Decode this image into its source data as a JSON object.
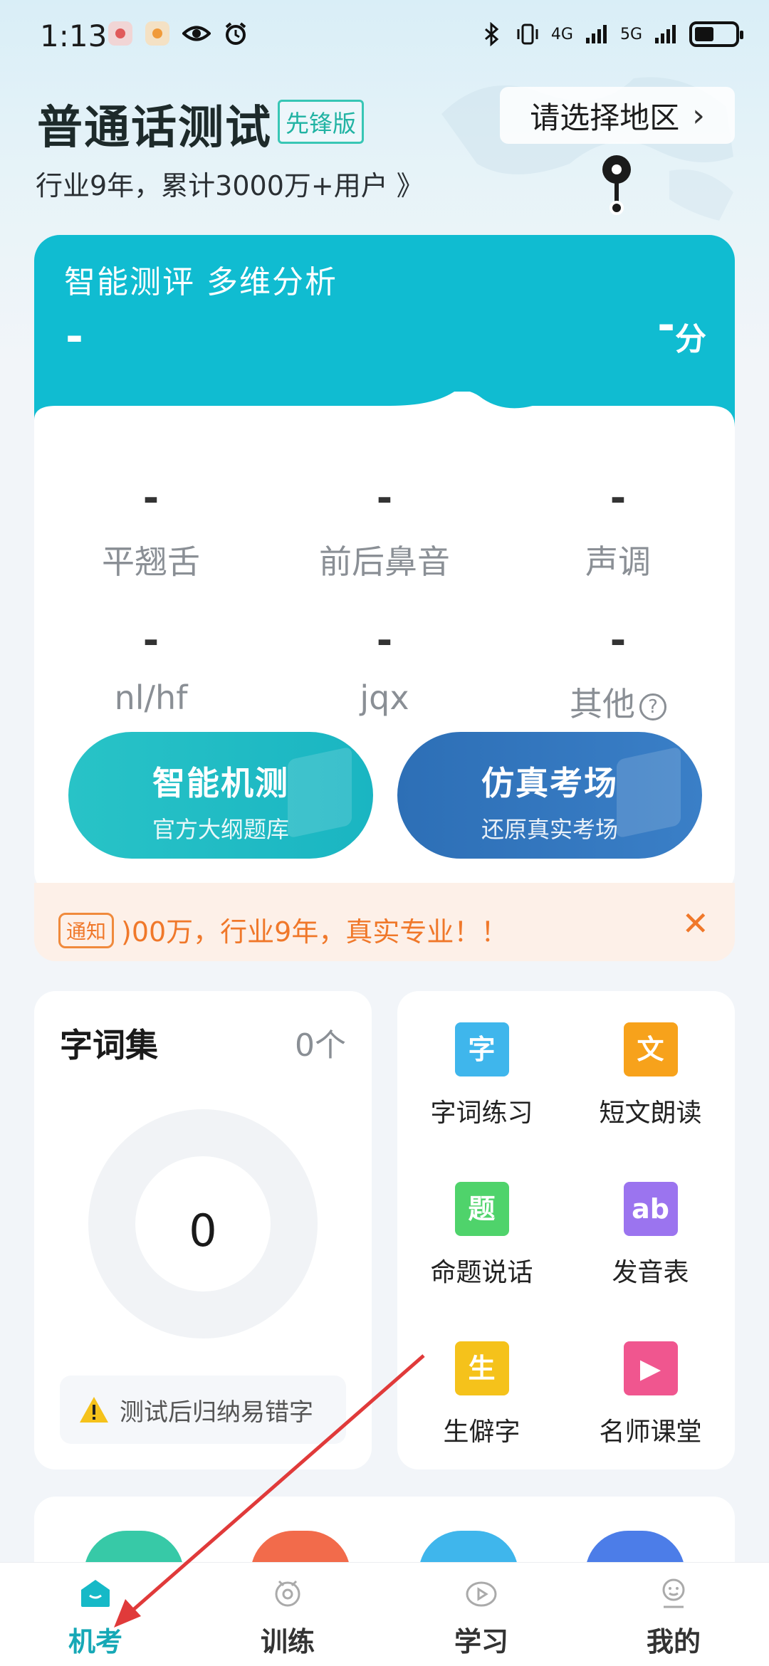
{
  "status_bar": {
    "time": "1:13",
    "network_4g": "4G",
    "network_5g": "5G"
  },
  "header": {
    "title": "普通话测试",
    "edition": "先锋版",
    "subtitle": "行业9年，累计3000万+用户 》",
    "region_label": "请选择地区"
  },
  "score_card": {
    "slogan": "智能测评 多维分析",
    "left_value": "-",
    "score_value": "-",
    "score_unit": "分",
    "metrics": [
      {
        "value": "-",
        "label": "平翘舌"
      },
      {
        "value": "-",
        "label": "前后鼻音"
      },
      {
        "value": "-",
        "label": "声调"
      },
      {
        "value": "-",
        "label": "nl/hf"
      },
      {
        "value": "-",
        "label": "jqx"
      },
      {
        "value": "-",
        "label": "其他"
      }
    ],
    "help_icon": "?",
    "buttons": [
      {
        "title": "智能机测",
        "subtitle": "官方大纲题库"
      },
      {
        "title": "仿真考场",
        "subtitle": "还原真实考场"
      }
    ]
  },
  "notice": {
    "badge": "通知",
    "text": ")00万，行业9年，真实专业！！",
    "close_symbol": "✕"
  },
  "word_set": {
    "title": "字词集",
    "count": "0个",
    "ring_value": "0",
    "tip": "测试后归纳易错字"
  },
  "features": [
    {
      "glyph": "字",
      "label": "字词练习",
      "color": "#3fb6ec",
      "icon": "word-practice-icon"
    },
    {
      "glyph": "文",
      "label": "短文朗读",
      "color": "#f7a21b",
      "icon": "article-reading-icon"
    },
    {
      "glyph": "题",
      "label": "命题说话",
      "color": "#4fd36b",
      "icon": "topic-speech-icon"
    },
    {
      "glyph": "ab",
      "label": "发音表",
      "color": "#9b74ef",
      "icon": "pronunciation-table-icon"
    },
    {
      "glyph": "生",
      "label": "生僻字",
      "color": "#f5c21b",
      "icon": "rare-chars-icon"
    },
    {
      "glyph": "▶",
      "label": "名师课堂",
      "color": "#f0568f",
      "icon": "video-class-icon"
    }
  ],
  "tabs": [
    {
      "label": "机考",
      "active": true,
      "icon": "exam-icon"
    },
    {
      "label": "训练",
      "active": false,
      "icon": "training-icon"
    },
    {
      "label": "学习",
      "active": false,
      "icon": "study-icon"
    },
    {
      "label": "我的",
      "active": false,
      "icon": "profile-icon"
    }
  ],
  "colors": {
    "accent": "#10bcd1",
    "active_tab": "#16a8b6",
    "notice": "#f0782a",
    "annotation_arrow": "#e03a3a"
  }
}
